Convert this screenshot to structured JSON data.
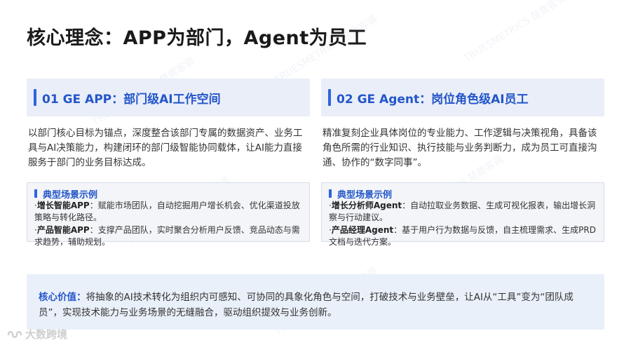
{
  "page": {
    "title": "核心理念：APP为部门，Agent为员工"
  },
  "watermark": {
    "text": "TRUESMETRICS 楚鹿客调"
  },
  "left": {
    "heading": "01 GE APP：部门级AI工作空间",
    "description": "以部门核心目标为锚点，深度整合该部门专属的数据资产、业务工具与AI决策能力，构建闭环的部门级智能协同载体，让AI能力直接服务于部门的业务目标达成。",
    "scenario_title": "典型场景示例",
    "items": [
      {
        "name": "增长智能APP",
        "text": "赋能市场团队，自动挖掘用户增长机会、优化渠道投放策略与转化路径。"
      },
      {
        "name": "产品智能APP",
        "text": "支撑产品团队，实时聚合分析用户反馈、竞品动态与需求趋势，辅助规划。"
      }
    ]
  },
  "right": {
    "heading": "02 GE Agent：岗位角色级AI员工",
    "description": "精准复刻企业具体岗位的专业能力、工作逻辑与决策视角，具备该角色所需的行业知识、执行技能与业务判断力，成为员工可直接沟通、协作的“数字同事”。",
    "scenario_title": "典型场景示例",
    "items": [
      {
        "name": "增长分析师Agent",
        "text": "自动拉取业务数据、生成可视化报表，输出增长洞察与行动建议。"
      },
      {
        "name": "产品经理Agent",
        "text": "基于用户行为数据与反馈，自主梳理需求、生成PRD文档与迭代方案。"
      }
    ]
  },
  "value": {
    "label": "核心价值：",
    "text": "将抽象的AI技术转化为组织内可感知、可协同的具象化角色与空间，打破技术与业务壁垒，让AI从“工具”变为“团队成员”，实现技术能力与业务场景的无缝融合，驱动组织提效与业务创新。"
  },
  "logo": {
    "text": "大数跨境"
  },
  "colors": {
    "accent": "#2f63e0",
    "heading_text": "#2456c9",
    "card_bg": "#e9eef9",
    "value_bg": "#eaf0fa"
  }
}
